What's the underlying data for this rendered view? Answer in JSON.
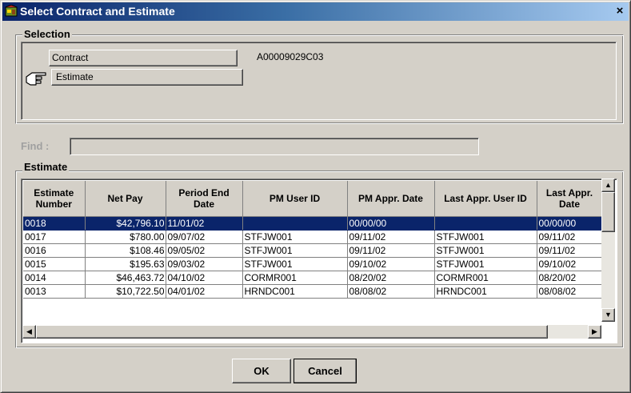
{
  "window": {
    "title": "Select Contract and Estimate",
    "close_label": "×"
  },
  "selection": {
    "legend": "Selection",
    "contract_label": "Contract",
    "contract_value": "A00009029C03",
    "estimate_label": "Estimate"
  },
  "find": {
    "label": "Find :",
    "value": ""
  },
  "estimate_group": {
    "legend": "Estimate"
  },
  "table": {
    "columns": [
      "Estimate Number",
      "Net Pay",
      "Period End Date",
      "PM User ID",
      "PM Appr. Date",
      "Last Appr. User ID",
      "Last Appr. Date"
    ],
    "rows": [
      [
        "0018",
        "$42,796.10",
        "11/01/02",
        "",
        "00/00/00",
        "",
        "00/00/00"
      ],
      [
        "0017",
        "$780.00",
        "09/07/02",
        "STFJW001",
        "09/11/02",
        "STFJW001",
        "09/11/02"
      ],
      [
        "0016",
        "$108.46",
        "09/05/02",
        "STFJW001",
        "09/11/02",
        "STFJW001",
        "09/11/02"
      ],
      [
        "0015",
        "$195.63",
        "09/03/02",
        "STFJW001",
        "09/10/02",
        "STFJW001",
        "09/10/02"
      ],
      [
        "0014",
        "$46,463.72",
        "04/10/02",
        "CORMR001",
        "08/20/02",
        "CORMR001",
        "08/20/02"
      ],
      [
        "0013",
        "$10,722.50",
        "04/01/02",
        "HRNDC001",
        "08/08/02",
        "HRNDC001",
        "08/08/02"
      ]
    ],
    "selected_row": 0
  },
  "buttons": {
    "ok_label": "OK",
    "cancel_label": "Cancel"
  },
  "colors": {
    "title_bar": "#0a246a",
    "selection_highlight": "#0a246a",
    "window_face": "#d4d0c8"
  },
  "icons": {
    "app": "app-icon",
    "pointer": "pointing-hand-icon",
    "close": "close-icon"
  }
}
